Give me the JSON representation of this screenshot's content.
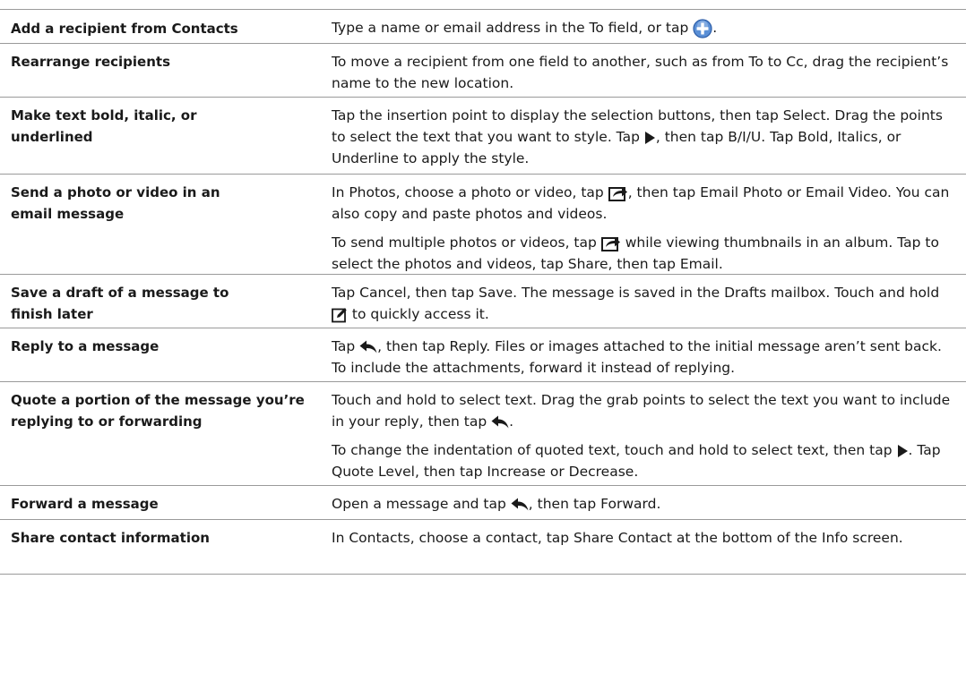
{
  "rows": [
    {
      "task": "Add a recipient from Contacts",
      "desc": [
        [
          {
            "t": "Type a name or email address in the To field, or tap "
          },
          {
            "i": "add"
          },
          {
            "t": "."
          }
        ]
      ]
    },
    {
      "task": "Rearrange recipients",
      "desc": [
        [
          {
            "t": "To move a recipient from one field to another, such as from To to Cc, drag the recipient’s name to the new location."
          }
        ]
      ]
    },
    {
      "task": "Make text bold, italic, or underlined",
      "desc": [
        [
          {
            "t": "Tap the insertion point to display the selection buttons, then tap Select. Drag the points to select the text that you want to style. Tap "
          },
          {
            "i": "play"
          },
          {
            "t": ", then tap B/I/U. Tap Bold, Italics, or Underline to apply the style."
          }
        ]
      ]
    },
    {
      "task": "Send a photo or video in an email message",
      "desc": [
        [
          {
            "t": "In Photos, choose a photo or video, tap "
          },
          {
            "i": "share"
          },
          {
            "t": ", then tap Email Photo or Email Video. You can also copy and paste photos and videos."
          }
        ],
        [
          {
            "t": "To send multiple photos or videos, tap "
          },
          {
            "i": "share"
          },
          {
            "t": " while viewing thumbnails in an album. Tap to select the photos and videos, tap Share, then tap Email."
          }
        ]
      ]
    },
    {
      "task": "Save a draft of a message to finish later",
      "desc": [
        [
          {
            "t": "Tap Cancel, then tap Save. The message is saved in the Drafts mailbox. Touch and hold "
          },
          {
            "i": "compose"
          },
          {
            "t": " to quickly access it."
          }
        ]
      ]
    },
    {
      "task": "Reply to a message",
      "desc": [
        [
          {
            "t": "Tap "
          },
          {
            "i": "reply"
          },
          {
            "t": ", then tap Reply. Files or images attached to the initial message aren’t sent back. To include the attachments, forward it instead of replying."
          }
        ]
      ]
    },
    {
      "task": "Quote a portion of the message you’re replying to or forwarding",
      "desc": [
        [
          {
            "t": "Touch and hold to select text. Drag the grab points to select the text you want to include in your reply, then tap "
          },
          {
            "i": "reply"
          },
          {
            "t": "."
          }
        ],
        [
          {
            "t": "To change the indentation of quoted text, touch and hold to select text, then tap "
          },
          {
            "i": "play"
          },
          {
            "t": ". Tap Quote Level, then tap Increase or Decrease."
          }
        ]
      ]
    },
    {
      "task": "Forward a message",
      "desc": [
        [
          {
            "t": "Open a message and tap "
          },
          {
            "i": "reply"
          },
          {
            "t": ", then tap Forward."
          }
        ]
      ]
    },
    {
      "task": "Share contact information",
      "desc": [
        [
          {
            "t": "In Contacts, choose a contact, tap Share Contact at the bottom of the Info screen."
          }
        ]
      ]
    }
  ]
}
